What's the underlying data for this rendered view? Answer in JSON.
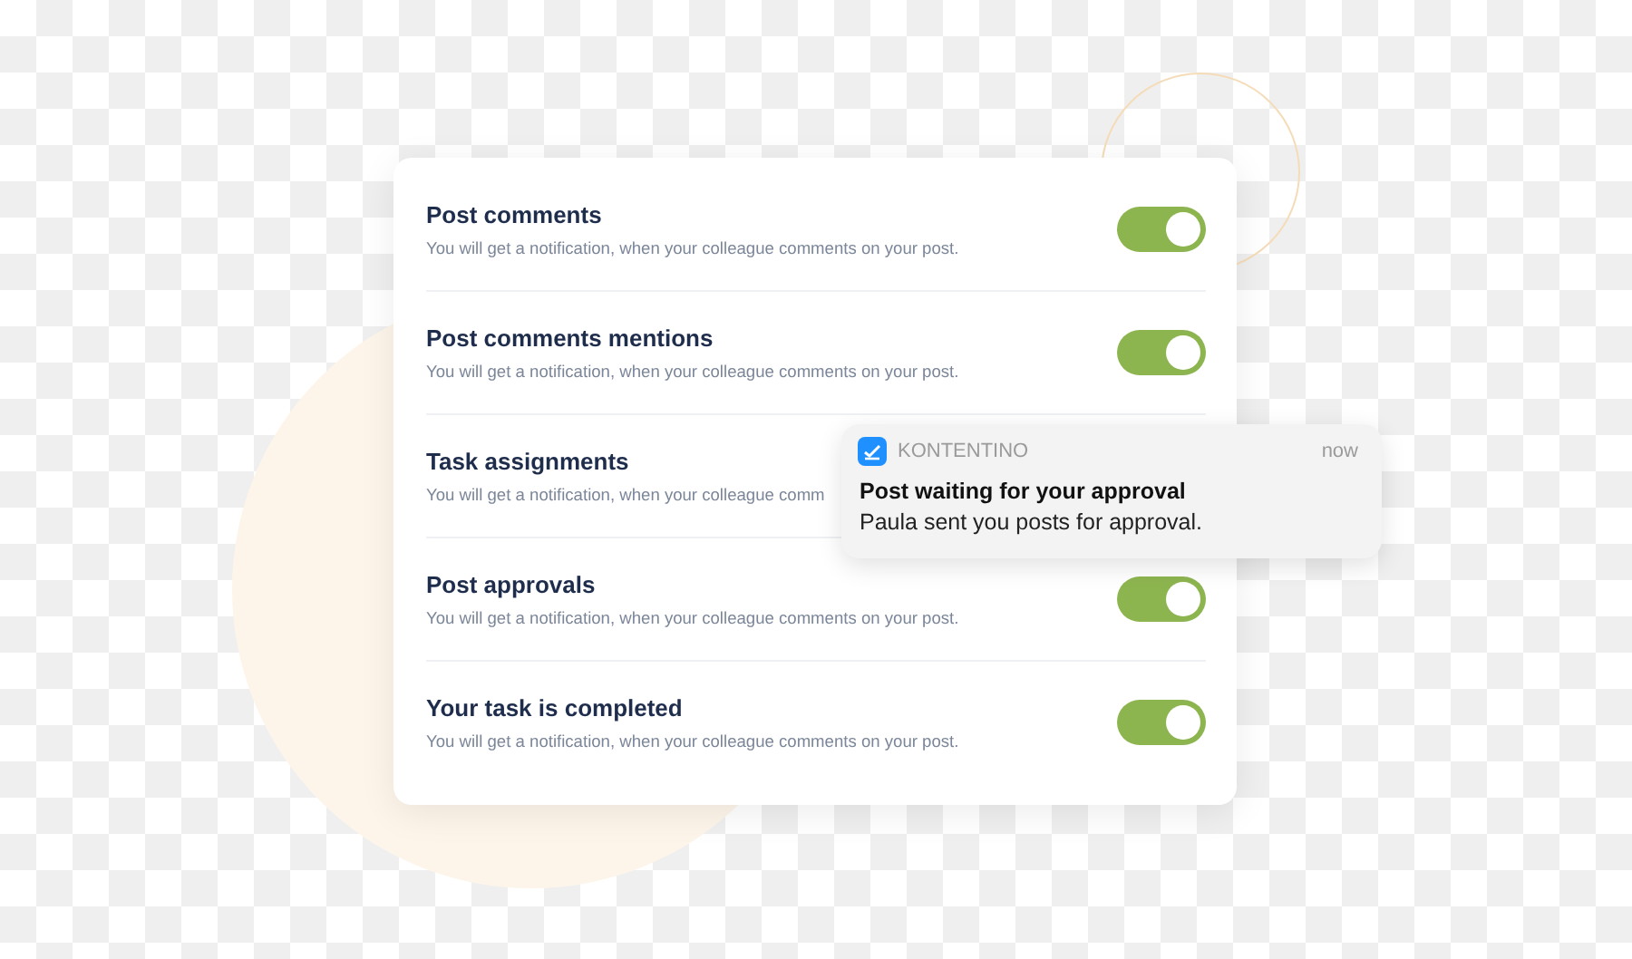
{
  "settings": [
    {
      "title": "Post comments",
      "description": "You will get a notification, when your colleague comments on your post.",
      "on": true
    },
    {
      "title": "Post comments mentions",
      "description": "You will get a notification, when your colleague comments on your post.",
      "on": true
    },
    {
      "title": "Task assignments",
      "description": "You will get a notification, when your colleague comm"
    },
    {
      "title": "Post approvals",
      "description": "You will get a notification, when your colleague comments on your post.",
      "on": true
    },
    {
      "title": "Your task is completed",
      "description": "You will get a notification, when your colleague comments on your post.",
      "on": true
    }
  ],
  "notification": {
    "app": "KONTENTINO",
    "time": "now",
    "title": "Post waiting for your approval",
    "body": "Paula sent you posts for approval."
  }
}
